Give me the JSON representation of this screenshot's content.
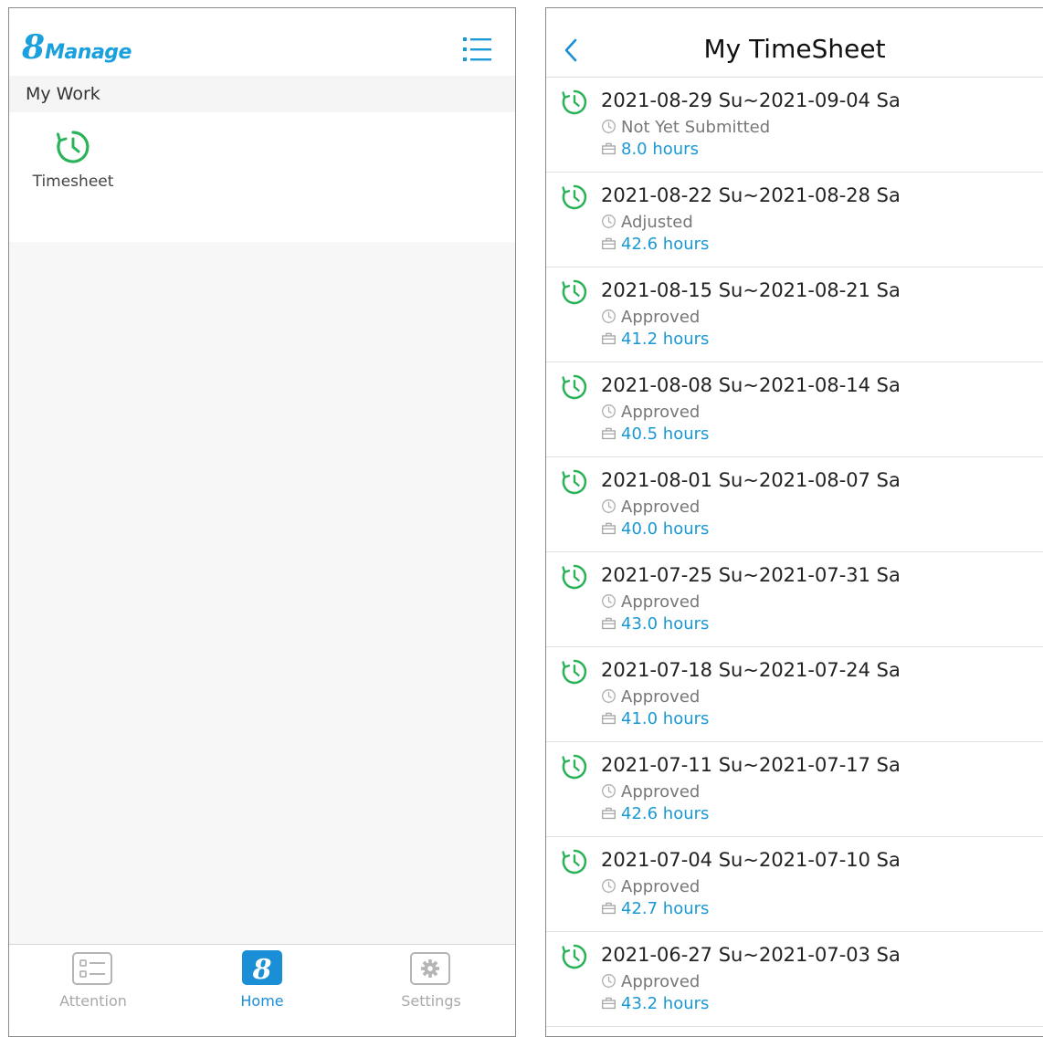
{
  "home": {
    "logo_big": "8",
    "logo_small": "Manage",
    "section_title": "My Work",
    "apps": [
      {
        "label": "Timesheet",
        "icon": "clock-icon"
      }
    ],
    "bottom_nav": [
      {
        "label": "Attention",
        "icon": "list-card-icon",
        "active": false
      },
      {
        "label": "Home",
        "icon": "eight-logo-icon",
        "active": true
      },
      {
        "label": "Settings",
        "icon": "gear-icon",
        "active": false
      }
    ]
  },
  "timesheet": {
    "title": "My TimeSheet",
    "entries": [
      {
        "period": "2021-08-29 Su~2021-09-04 Sa",
        "status": "Not Yet Submitted",
        "hours": "8.0 hours"
      },
      {
        "period": "2021-08-22 Su~2021-08-28 Sa",
        "status": "Adjusted",
        "hours": "42.6 hours"
      },
      {
        "period": "2021-08-15 Su~2021-08-21 Sa",
        "status": "Approved",
        "hours": "41.2 hours"
      },
      {
        "period": "2021-08-08 Su~2021-08-14 Sa",
        "status": "Approved",
        "hours": "40.5 hours"
      },
      {
        "period": "2021-08-01 Su~2021-08-07 Sa",
        "status": "Approved",
        "hours": "40.0 hours"
      },
      {
        "period": "2021-07-25 Su~2021-07-31 Sa",
        "status": "Approved",
        "hours": "43.0 hours"
      },
      {
        "period": "2021-07-18 Su~2021-07-24 Sa",
        "status": "Approved",
        "hours": "41.0 hours"
      },
      {
        "period": "2021-07-11 Su~2021-07-17 Sa",
        "status": "Approved",
        "hours": "42.6 hours"
      },
      {
        "period": "2021-07-04 Su~2021-07-10 Sa",
        "status": "Approved",
        "hours": "42.7 hours"
      },
      {
        "period": "2021-06-27 Su~2021-07-03 Sa",
        "status": "Approved",
        "hours": "43.2 hours"
      }
    ]
  },
  "colors": {
    "brand_blue": "#1aa0dc",
    "accent_green": "#2bb35a",
    "hours_blue": "#1a98d4",
    "active_nav": "#1a8fd6"
  }
}
